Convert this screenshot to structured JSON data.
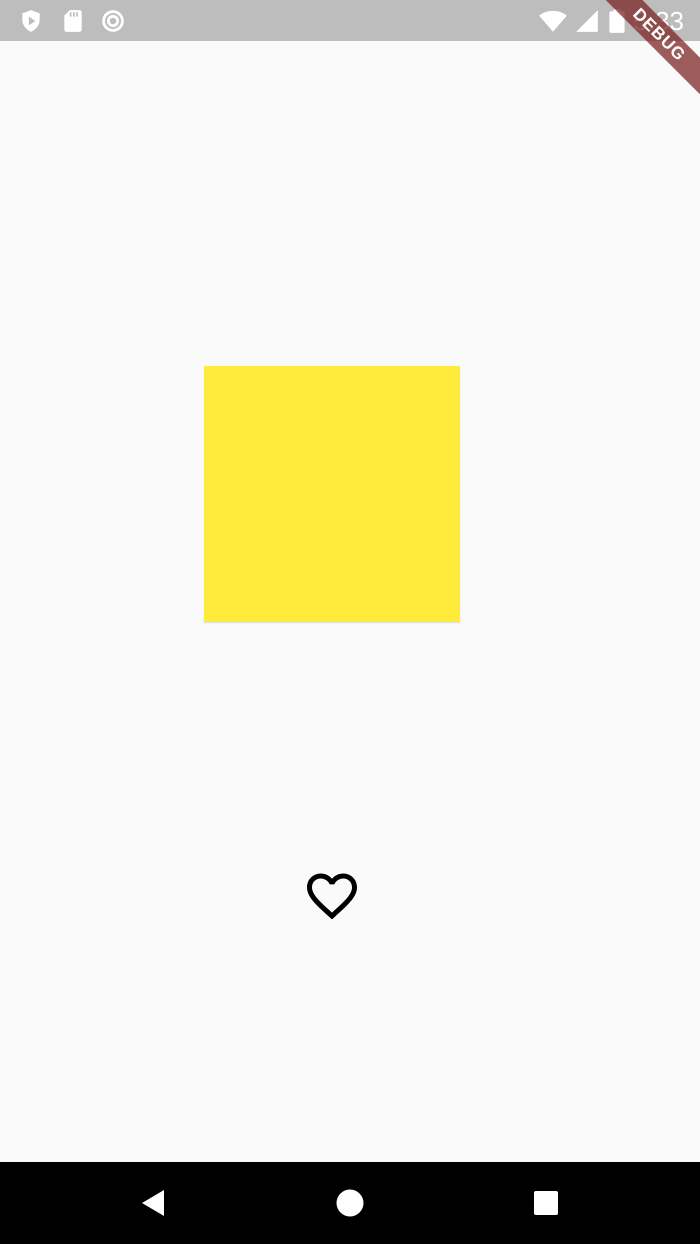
{
  "status_bar": {
    "time": "5:33",
    "icons": [
      "shield-icon",
      "sd-card-icon",
      "sync-icon",
      "wifi-icon",
      "signal-icon",
      "battery-icon"
    ]
  },
  "debug_banner": {
    "label": "DEBUG"
  },
  "main": {
    "box_color": "#ffeb3b",
    "heart_state": "outline",
    "heart_icon": "heart-outline-icon"
  },
  "nav_bar": {
    "buttons": [
      "back-icon",
      "home-icon",
      "recents-icon"
    ]
  }
}
